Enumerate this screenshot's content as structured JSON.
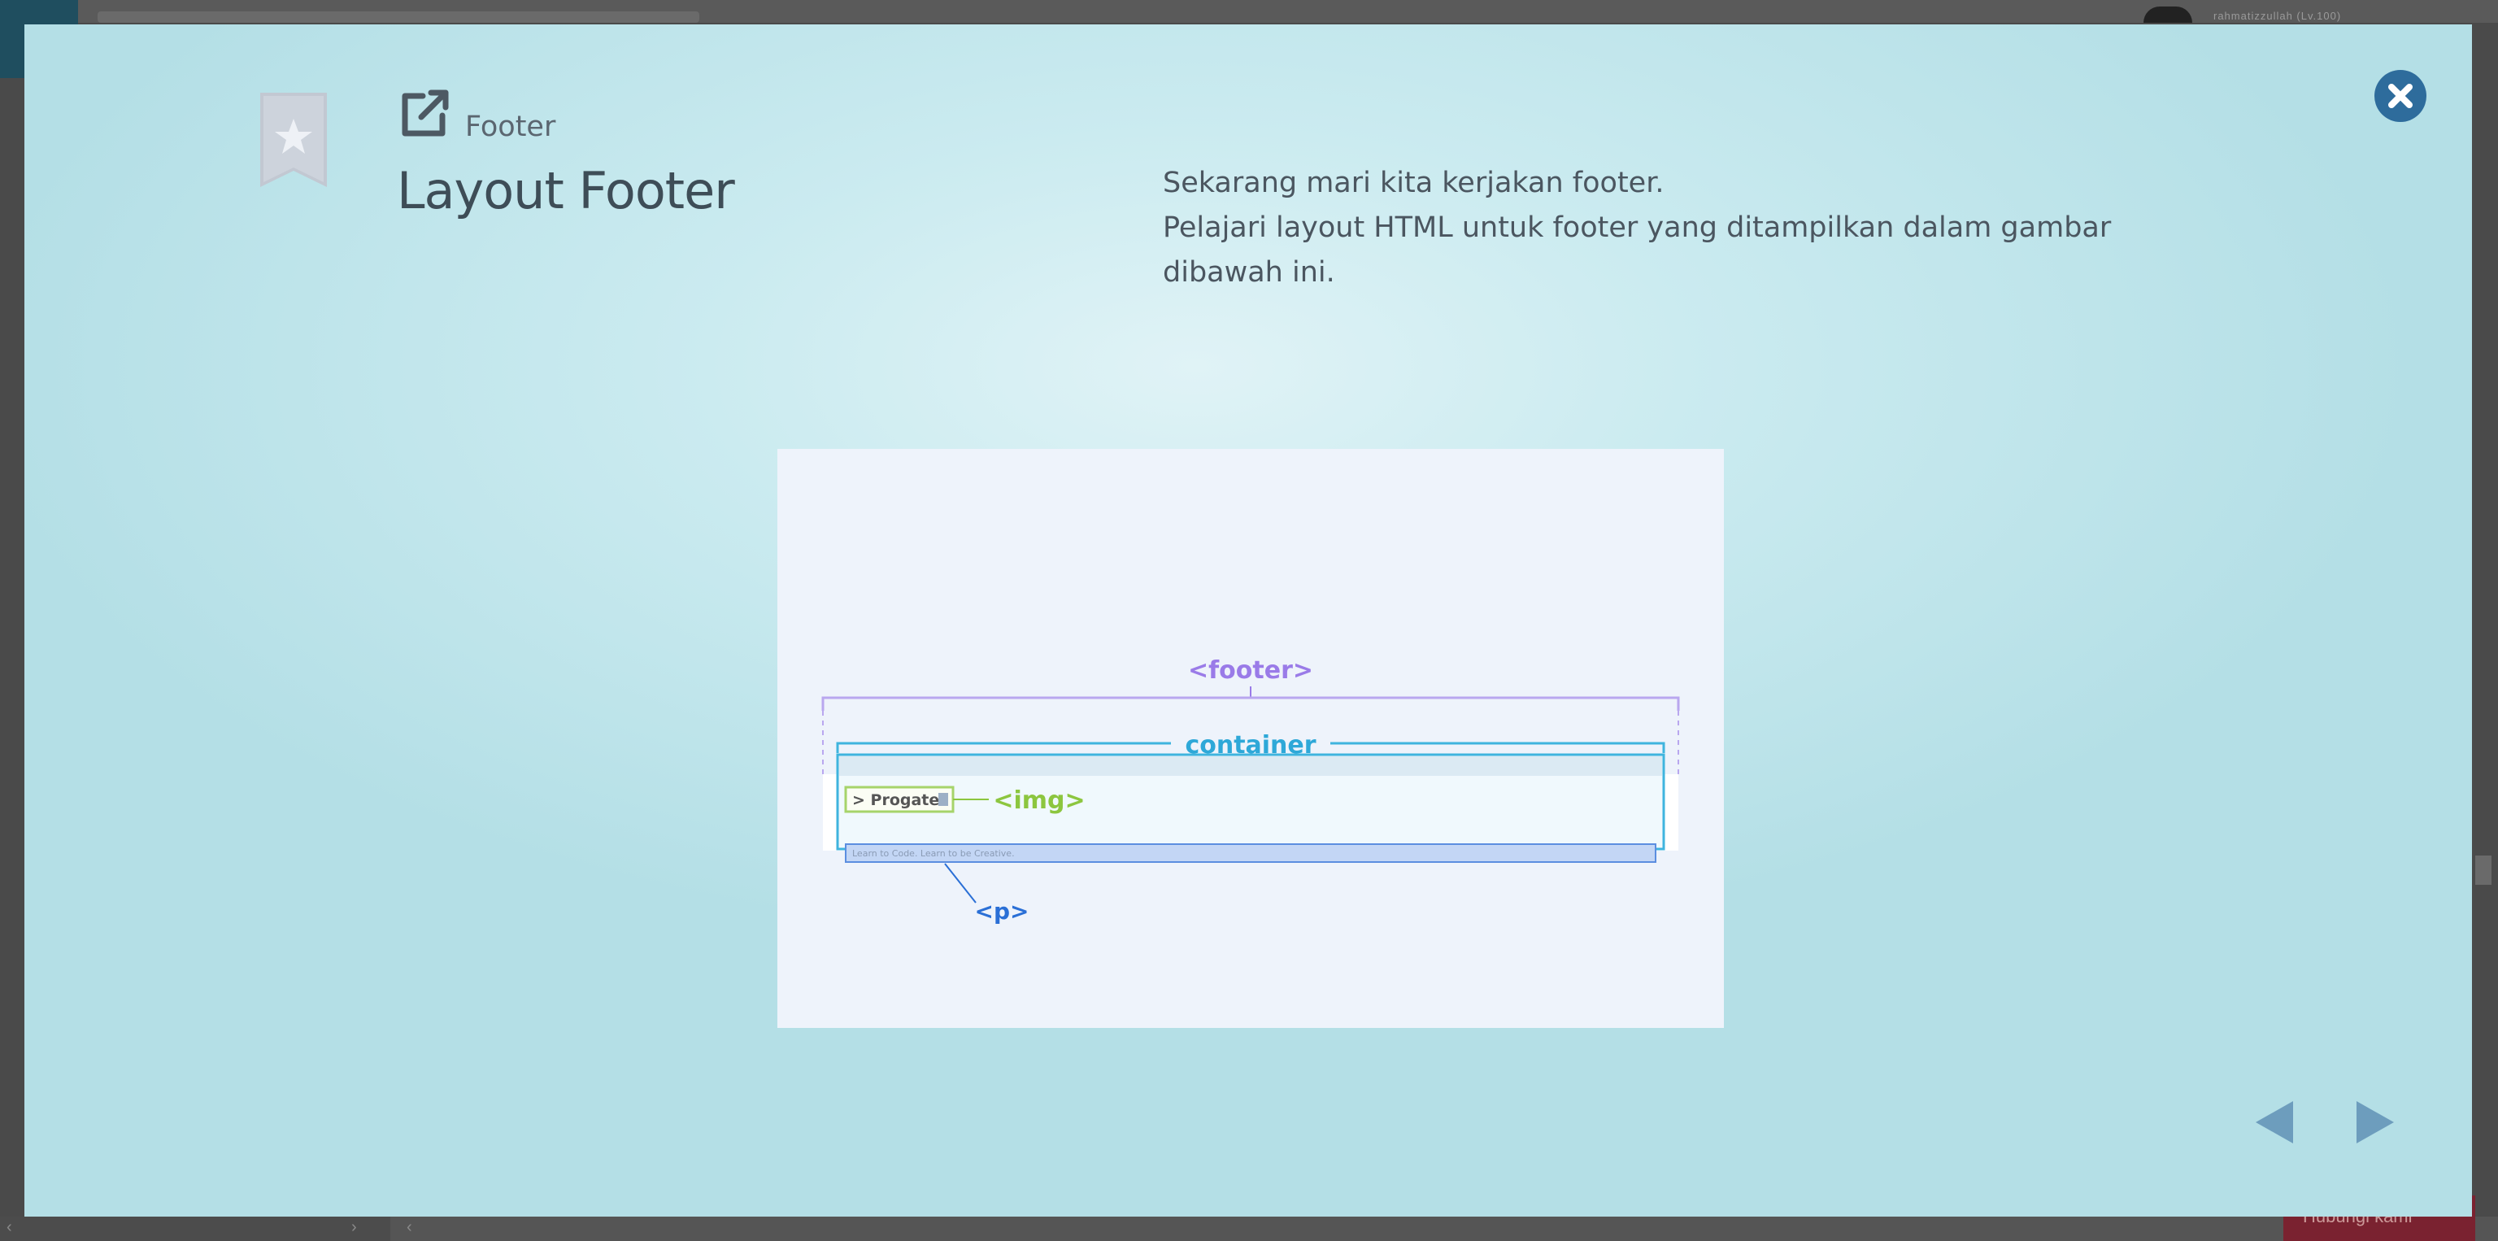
{
  "background": {
    "username": "rahmatizzullah (Lv.100)",
    "bottom_button": "Hubungi kami"
  },
  "modal": {
    "bookmark_icon": "star-bookmark-icon",
    "breadcrumb": {
      "icon": "external-link-icon",
      "label": "Footer"
    },
    "title": "Layout Footer",
    "description": [
      "Sekarang mari kita kerjakan footer.",
      "Pelajari layout HTML untuk footer yang ditampilkan dalam gambar",
      "dibawah ini."
    ],
    "close_icon": "close-icon",
    "illustration": {
      "footer_tag": "<footer>",
      "container_label": "container",
      "logo_text": "> Progate",
      "img_tag": "<img>",
      "tagline": "Learn to Code. Learn to be Creative.",
      "p_tag": "<p>"
    },
    "nav": {
      "prev_icon": "triangle-left-icon",
      "next_icon": "triangle-right-icon"
    },
    "colors": {
      "footer_tag": "#9a7be8",
      "container": "#2ea8d8",
      "img_tag": "#8cc63f",
      "p_tag": "#2a6fd6",
      "close": "#2e6c9c",
      "nav": "#6d9dbd"
    }
  }
}
